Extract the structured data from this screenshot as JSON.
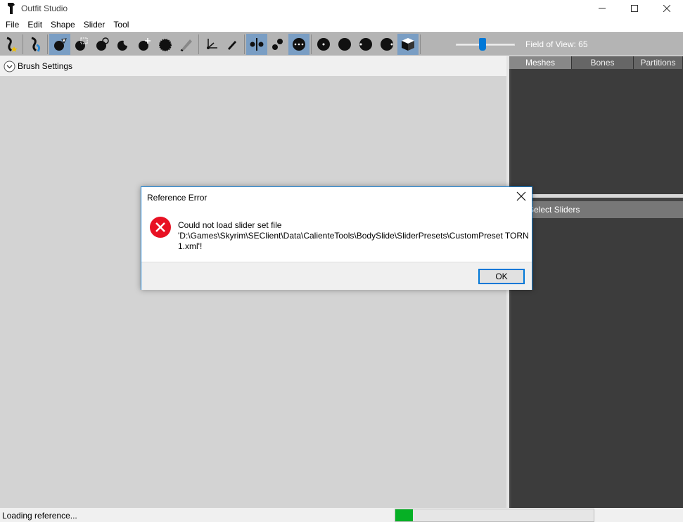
{
  "window": {
    "title": "Outfit Studio",
    "controls": {
      "minimize": "—",
      "maximize": "☐",
      "close": "✕"
    }
  },
  "menu": [
    "File",
    "Edit",
    "Shape",
    "Slider",
    "Tool"
  ],
  "toolbar": {
    "buttons": [
      {
        "name": "load-reference-icon",
        "active": false
      },
      {
        "name": "load-outfit-icon",
        "active": false
      },
      {
        "name": "select-brush-icon",
        "active": true
      },
      {
        "name": "mask-brush-icon",
        "active": false
      },
      {
        "name": "inflate-brush-icon",
        "active": false
      },
      {
        "name": "deflate-brush-icon",
        "active": false
      },
      {
        "name": "move-brush-icon",
        "active": false
      },
      {
        "name": "smooth-brush-icon",
        "active": false
      },
      {
        "name": "weight-brush-icon",
        "active": false
      },
      {
        "name": "transform-icon",
        "active": false
      },
      {
        "name": "pencil-icon",
        "active": false
      },
      {
        "name": "x-mirror-icon",
        "active": true
      },
      {
        "name": "connected-only-icon",
        "active": false
      },
      {
        "name": "global-brush-icon",
        "active": true
      },
      {
        "name": "vertex-dot-icon",
        "active": false
      },
      {
        "name": "wireframe-icon",
        "active": false
      },
      {
        "name": "lighting-icon",
        "active": false
      },
      {
        "name": "texture-icon",
        "active": false
      },
      {
        "name": "cube-view-icon",
        "active": true
      }
    ],
    "fov_label": "Field of View: 65",
    "fov_value": 65
  },
  "brush_settings": {
    "label": "Brush Settings"
  },
  "right_panel": {
    "tabs": [
      "Meshes",
      "Bones",
      "Partitions"
    ],
    "active_tab": "Meshes",
    "sliders_header": "e-/Select Sliders"
  },
  "status": {
    "text": "Loading reference...",
    "progress": 0.09
  },
  "dialog": {
    "title": "Reference Error",
    "message_line1": "Could not load slider set file",
    "message_line2": "'D:\\Games\\Skyrim\\SEClient\\Data\\CalienteTools\\BodySlide\\SliderPresets\\CustomPreset TORN",
    "message_line3": "1.xml'!",
    "ok_label": "OK",
    "icon": "error-icon",
    "icon_color": "#e81123"
  },
  "colors": {
    "toolbar_bg": "#b4b4b4",
    "active_button": "#7a9ec4",
    "accent": "#0078d7",
    "progress": "#06b025"
  }
}
